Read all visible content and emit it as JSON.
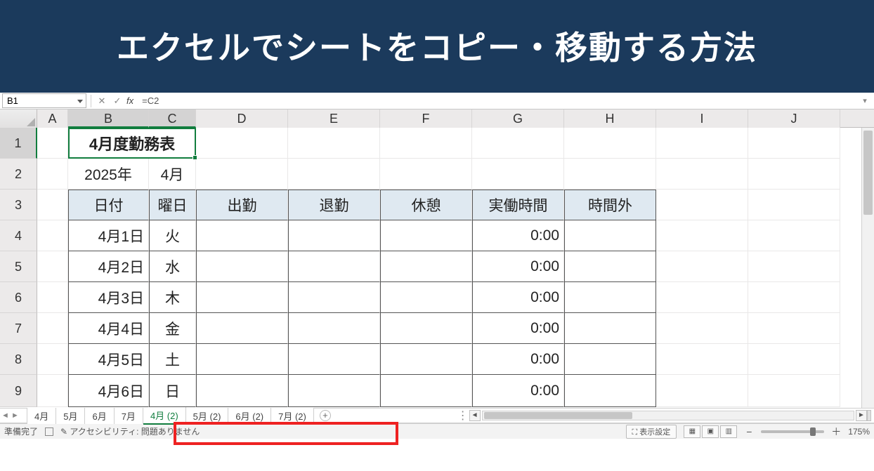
{
  "banner": {
    "title": "エクセルでシートをコピー・移動する方法"
  },
  "formula_bar": {
    "name_box": "B1",
    "cancel": "✕",
    "confirm": "✓",
    "fx": "fx",
    "formula": "=C2"
  },
  "columns": [
    "A",
    "B",
    "C",
    "D",
    "E",
    "F",
    "G",
    "H",
    "I",
    "J"
  ],
  "rows": [
    "1",
    "2",
    "3",
    "4",
    "5",
    "6",
    "7",
    "8",
    "9"
  ],
  "cells": {
    "title": "4月度勤務表",
    "year": "2025年",
    "month": "4月",
    "hdr_date": "日付",
    "hdr_dow": "曜日",
    "hdr_in": "出勤",
    "hdr_out": "退勤",
    "hdr_break": "休憩",
    "hdr_work": "実働時間",
    "hdr_ot": "時間外"
  },
  "data_rows": [
    {
      "date": "4月1日",
      "dow": "火",
      "work": "0:00"
    },
    {
      "date": "4月2日",
      "dow": "水",
      "work": "0:00"
    },
    {
      "date": "4月3日",
      "dow": "木",
      "work": "0:00"
    },
    {
      "date": "4月4日",
      "dow": "金",
      "work": "0:00"
    },
    {
      "date": "4月5日",
      "dow": "土",
      "work": "0:00"
    },
    {
      "date": "4月6日",
      "dow": "日",
      "work": "0:00"
    }
  ],
  "tabs": [
    "4月",
    "5月",
    "6月",
    "7月",
    "4月 (2)",
    "5月 (2)",
    "6月 (2)",
    "7月 (2)"
  ],
  "active_tab_index": 4,
  "status": {
    "ready": "準備完了",
    "accessibility": "アクセシビリティ: 問題ありません",
    "display_settings": "表示設定",
    "zoom": "175%"
  }
}
